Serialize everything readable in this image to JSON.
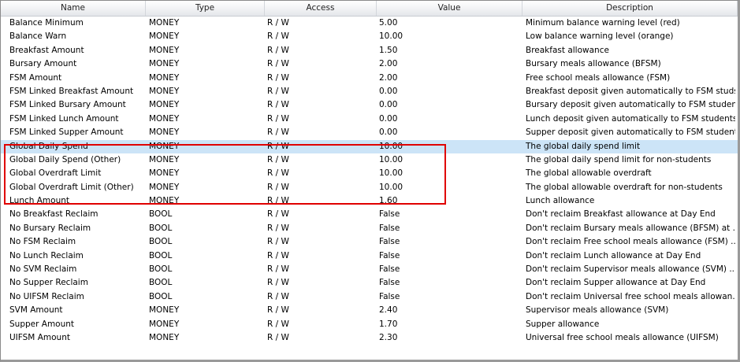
{
  "columns": [
    "Name",
    "Type",
    "Access",
    "Value",
    "Description"
  ],
  "rows": [
    {
      "name": "Balance Minimum",
      "type": "MONEY",
      "access": "R / W",
      "value": "5.00",
      "desc": "Minimum balance warning level (red)"
    },
    {
      "name": "Balance Warn",
      "type": "MONEY",
      "access": "R / W",
      "value": "10.00",
      "desc": "Low balance warning level (orange)"
    },
    {
      "name": "Breakfast Amount",
      "type": "MONEY",
      "access": "R / W",
      "value": "1.50",
      "desc": "Breakfast allowance"
    },
    {
      "name": "Bursary Amount",
      "type": "MONEY",
      "access": "R / W",
      "value": "2.00",
      "desc": "Bursary meals allowance (BFSM)"
    },
    {
      "name": "FSM Amount",
      "type": "MONEY",
      "access": "R / W",
      "value": "2.00",
      "desc": "Free school meals allowance (FSM)"
    },
    {
      "name": "FSM Linked Breakfast Amount",
      "type": "MONEY",
      "access": "R / W",
      "value": "0.00",
      "desc": "Breakfast deposit given automatically to FSM studs..."
    },
    {
      "name": "FSM Linked Bursary Amount",
      "type": "MONEY",
      "access": "R / W",
      "value": "0.00",
      "desc": "Bursary deposit given automatically to FSM students"
    },
    {
      "name": "FSM Linked Lunch Amount",
      "type": "MONEY",
      "access": "R / W",
      "value": "0.00",
      "desc": "Lunch deposit given automatically to FSM students"
    },
    {
      "name": "FSM Linked Supper Amount",
      "type": "MONEY",
      "access": "R / W",
      "value": "0.00",
      "desc": "Supper deposit given automatically to FSM students"
    },
    {
      "name": "Global Daily Spend",
      "type": "MONEY",
      "access": "R / W",
      "value": "10.00",
      "desc": "The global daily spend limit"
    },
    {
      "name": "Global Daily Spend (Other)",
      "type": "MONEY",
      "access": "R / W",
      "value": "10.00",
      "desc": "The global daily spend limit for non-students"
    },
    {
      "name": "Global Overdraft Limit",
      "type": "MONEY",
      "access": "R / W",
      "value": "10.00",
      "desc": "The global allowable overdraft"
    },
    {
      "name": "Global Overdraft Limit (Other)",
      "type": "MONEY",
      "access": "R / W",
      "value": "10.00",
      "desc": "The global allowable overdraft for non-students"
    },
    {
      "name": "Lunch Amount",
      "type": "MONEY",
      "access": "R / W",
      "value": "1.60",
      "desc": "Lunch allowance"
    },
    {
      "name": "No Breakfast Reclaim",
      "type": "BOOL",
      "access": "R / W",
      "value": "False",
      "desc": "Don't reclaim Breakfast allowance at Day End"
    },
    {
      "name": "No Bursary Reclaim",
      "type": "BOOL",
      "access": "R / W",
      "value": "False",
      "desc": "Don't reclaim Bursary meals allowance (BFSM) at ..."
    },
    {
      "name": "No FSM Reclaim",
      "type": "BOOL",
      "access": "R / W",
      "value": "False",
      "desc": "Don't reclaim Free school meals allowance (FSM) ..."
    },
    {
      "name": "No Lunch Reclaim",
      "type": "BOOL",
      "access": "R / W",
      "value": "False",
      "desc": "Don't reclaim Lunch allowance at Day End"
    },
    {
      "name": "No SVM Reclaim",
      "type": "BOOL",
      "access": "R / W",
      "value": "False",
      "desc": "Don't reclaim Supervisor meals allowance (SVM) ..."
    },
    {
      "name": "No Supper Reclaim",
      "type": "BOOL",
      "access": "R / W",
      "value": "False",
      "desc": "Don't reclaim Supper allowance at Day End"
    },
    {
      "name": "No UIFSM Reclaim",
      "type": "BOOL",
      "access": "R / W",
      "value": "False",
      "desc": "Don't reclaim Universal free school meals allowan..."
    },
    {
      "name": "SVM Amount",
      "type": "MONEY",
      "access": "R / W",
      "value": "2.40",
      "desc": "Supervisor meals allowance (SVM)"
    },
    {
      "name": "Supper Amount",
      "type": "MONEY",
      "access": "R / W",
      "value": "1.70",
      "desc": "Supper allowance"
    },
    {
      "name": "UIFSM Amount",
      "type": "MONEY",
      "access": "R / W",
      "value": "2.30",
      "desc": "Universal free school meals allowance (UIFSM)"
    }
  ],
  "selected_row_index": 9
}
